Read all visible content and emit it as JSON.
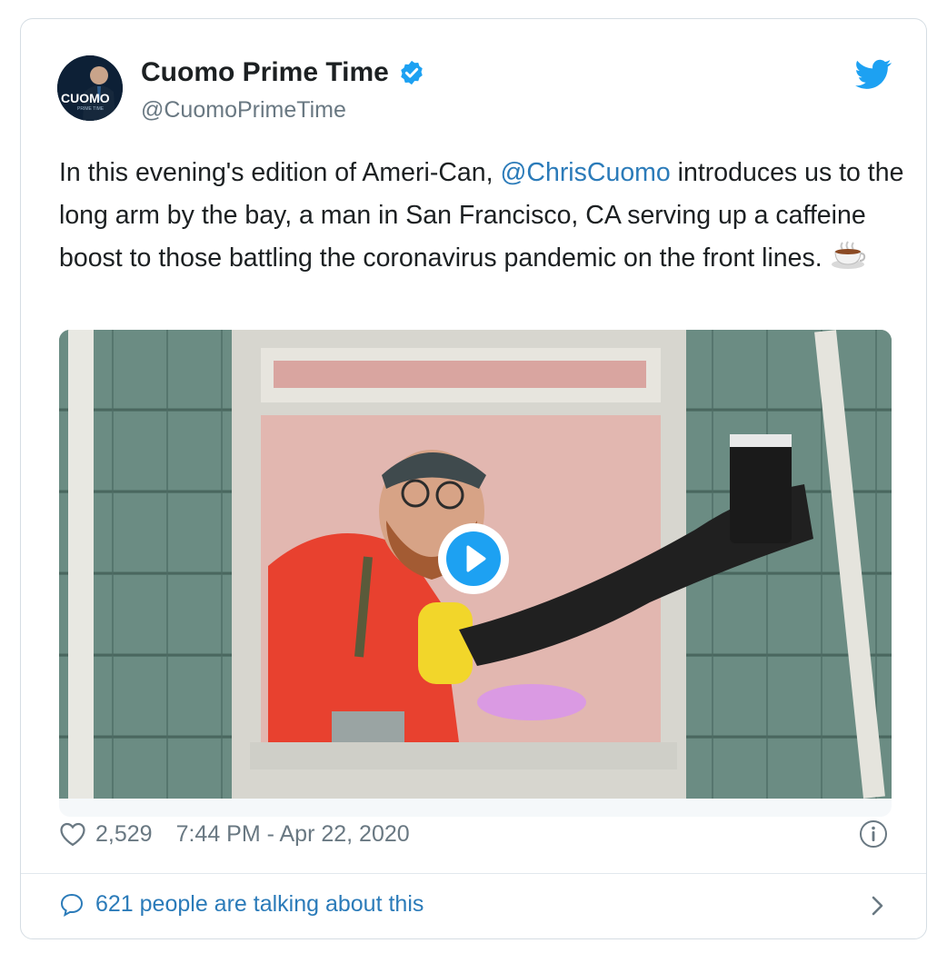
{
  "account": {
    "name": "Cuomo Prime Time",
    "handle": "@CuomoPrimeTime",
    "avatar_text": "CUOMO",
    "avatar_subtext": "PRIME TIME"
  },
  "tweet": {
    "text_before": "In this evening's edition of Ameri-Can, ",
    "mention": "@ChrisCuomo",
    "text_after": " introduces us to the long arm by the bay, a man in San Francisco, CA serving up a caffeine boost to those battling the coronavirus pandemic on the front lines. "
  },
  "stats": {
    "likes": "2,529",
    "timestamp": "7:44 PM - Apr 22, 2020"
  },
  "footer": {
    "talking": "621 people are talking about this"
  },
  "icons": {
    "verified": "verified-badge-icon",
    "brand": "twitter-bird-icon",
    "play": "play-icon",
    "like": "heart-icon",
    "info": "info-icon",
    "reply": "speech-bubble-icon",
    "chevron": "chevron-right-icon",
    "emoji": "hot-beverage-emoji"
  },
  "colors": {
    "link": "#2b7bb9",
    "brand": "#1da1f2",
    "muted": "#697882",
    "text": "#1c2022"
  }
}
